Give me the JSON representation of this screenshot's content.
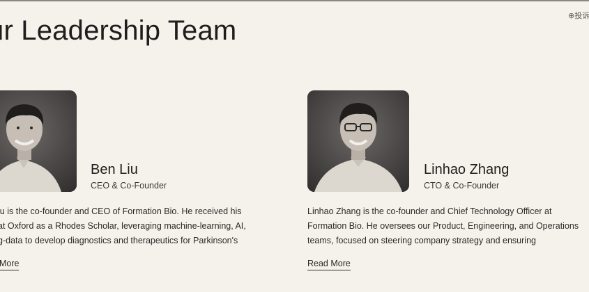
{
  "section": {
    "title": "ur Leadership Team"
  },
  "corner_mark": "⊕投诉",
  "members": [
    {
      "name": "Ben Liu",
      "role": "CEO & Co-Founder",
      "bio_lines": [
        "iu is the co-founder and CEO of Formation Bio. He received his",
        "at Oxford as a Rhodes Scholar, leveraging machine-learning, AI,",
        "g-data to develop diagnostics and therapeutics for Parkinson's"
      ],
      "read_more": "More"
    },
    {
      "name": "Linhao Zhang",
      "role": "CTO & Co-Founder",
      "bio_lines": [
        "Linhao Zhang is the co-founder and Chief Technology Officer at",
        "Formation Bio. He oversees our Product, Engineering, and Operations",
        "teams, focused on steering company strategy and ensuring"
      ],
      "read_more": "Read More"
    }
  ]
}
